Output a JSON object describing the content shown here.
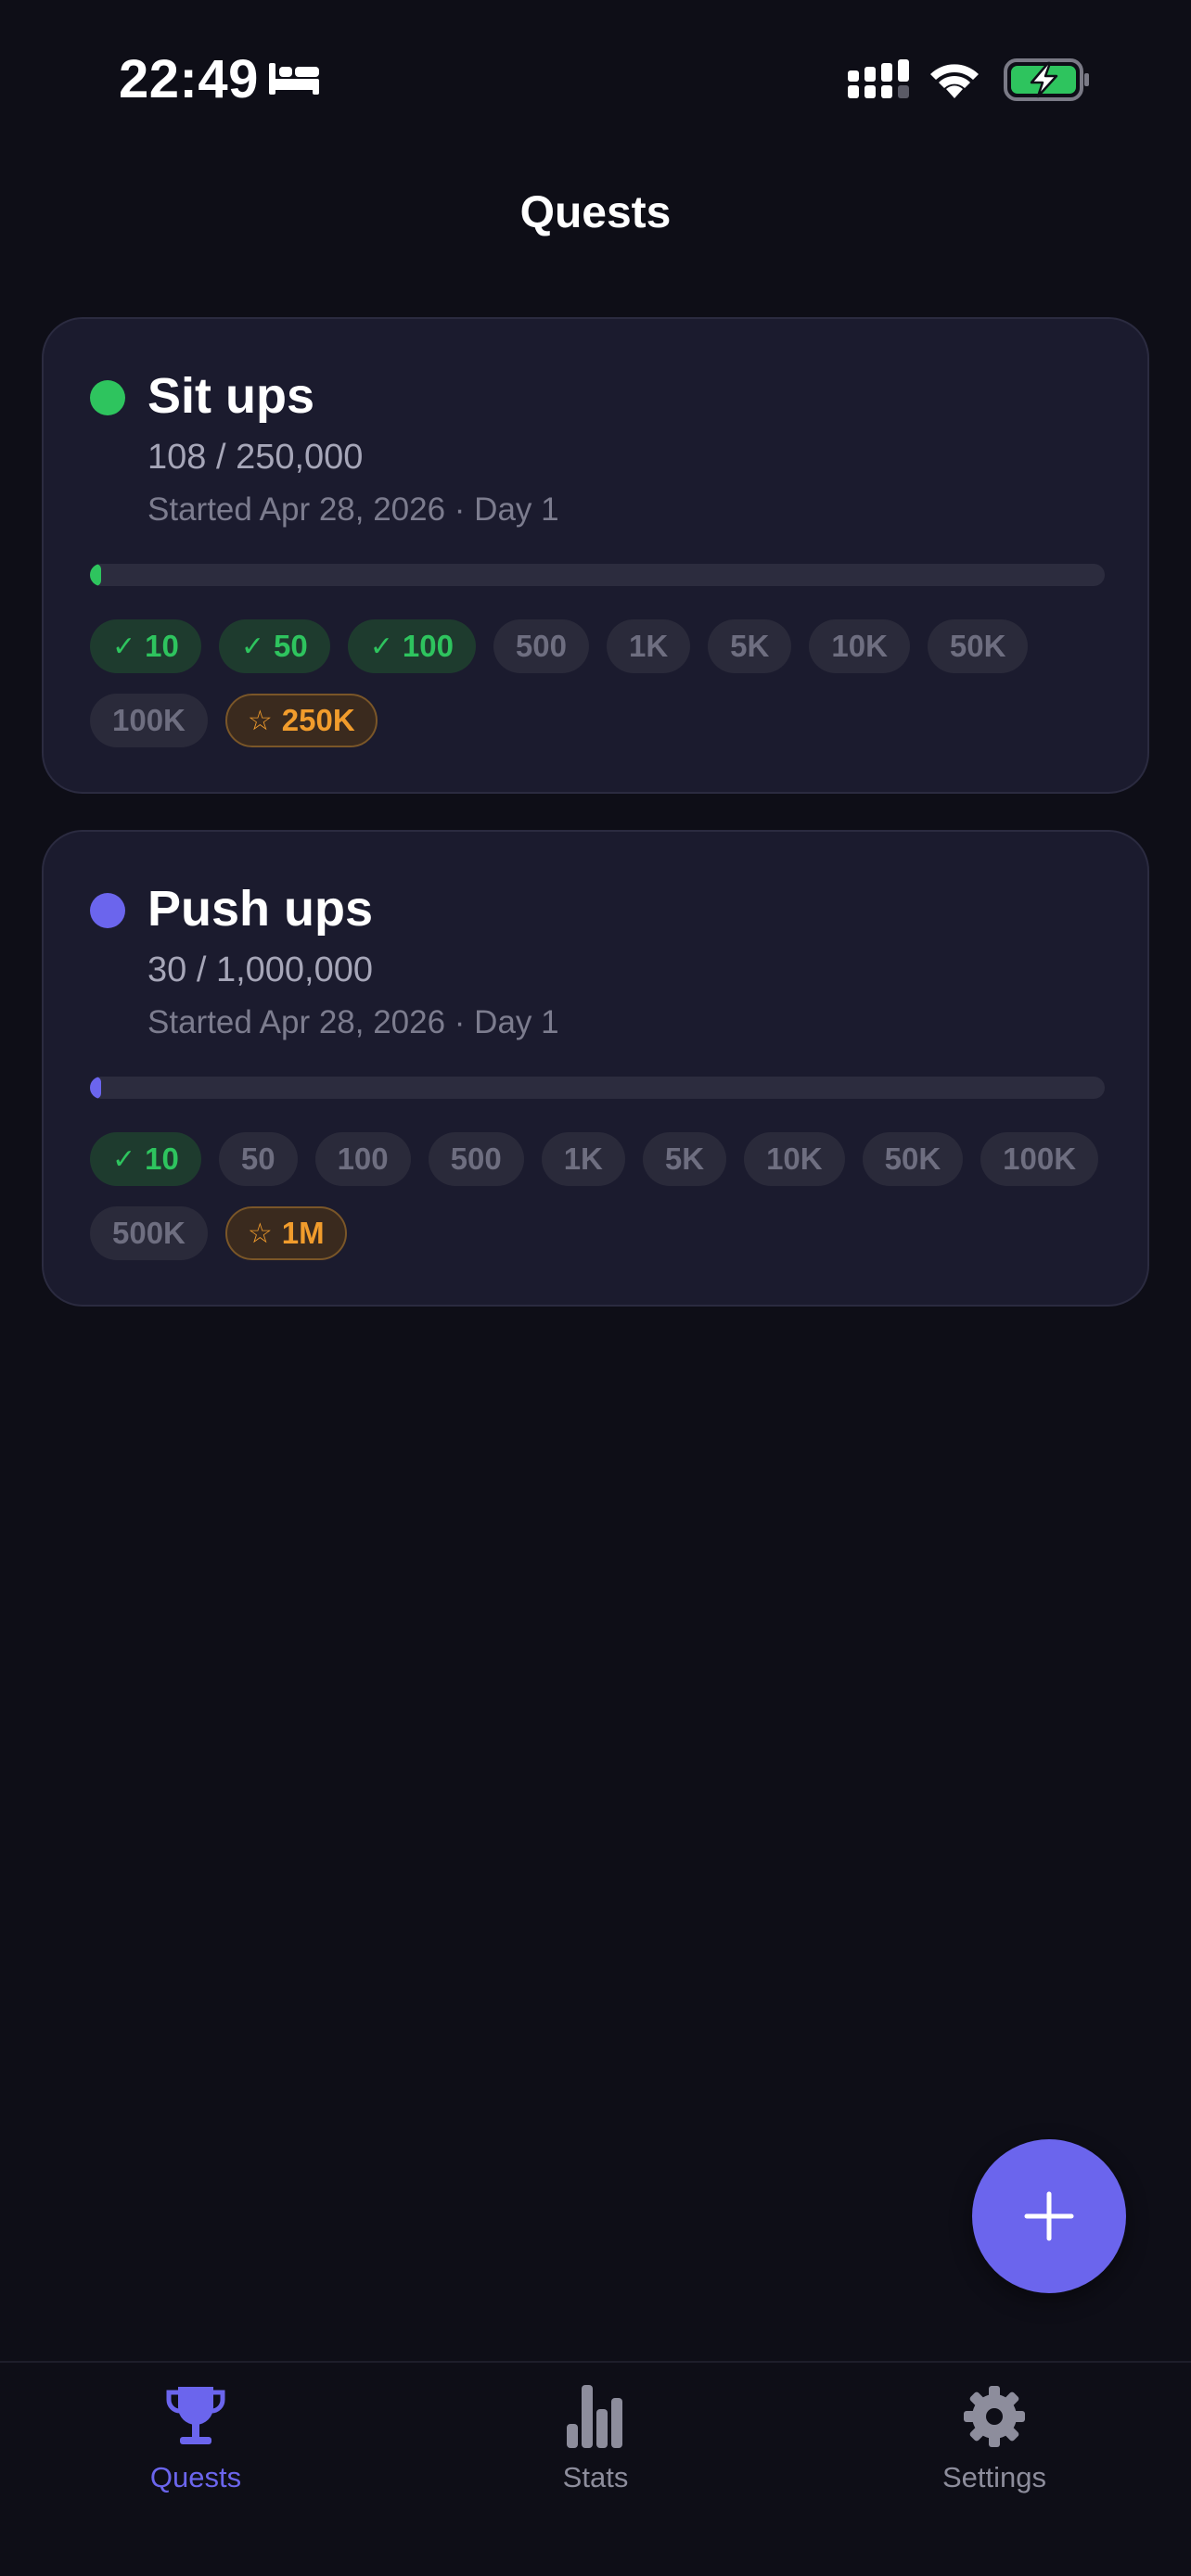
{
  "status_bar": {
    "time": "22:49",
    "icons": [
      "bed-icon",
      "signal-icon",
      "wifi-icon",
      "battery-charging-icon"
    ]
  },
  "header": {
    "title": "Quests"
  },
  "quests": [
    {
      "name": "Sit ups",
      "dot_color": "#2ec45e",
      "progress_text": "108 / 250,000",
      "started": "Started Apr 28, 2026 · Day 1",
      "progress_fraction": 0.000432,
      "milestones": [
        {
          "label": "10",
          "state": "done",
          "mark": "✓"
        },
        {
          "label": "50",
          "state": "done",
          "mark": "✓"
        },
        {
          "label": "100",
          "state": "done",
          "mark": "✓"
        },
        {
          "label": "500",
          "state": "todo",
          "mark": ""
        },
        {
          "label": "1K",
          "state": "todo",
          "mark": ""
        },
        {
          "label": "5K",
          "state": "todo",
          "mark": ""
        },
        {
          "label": "10K",
          "state": "todo",
          "mark": ""
        },
        {
          "label": "50K",
          "state": "todo",
          "mark": ""
        },
        {
          "label": "100K",
          "state": "todo",
          "mark": ""
        },
        {
          "label": "250K",
          "state": "goal",
          "mark": "☆"
        }
      ]
    },
    {
      "name": "Push ups",
      "dot_color": "#6b65ed",
      "progress_text": "30 / 1,000,000",
      "started": "Started Apr 28, 2026 · Day 1",
      "progress_fraction": 3e-05,
      "milestones": [
        {
          "label": "10",
          "state": "done",
          "mark": "✓"
        },
        {
          "label": "50",
          "state": "todo",
          "mark": ""
        },
        {
          "label": "100",
          "state": "todo",
          "mark": ""
        },
        {
          "label": "500",
          "state": "todo",
          "mark": ""
        },
        {
          "label": "1K",
          "state": "todo",
          "mark": ""
        },
        {
          "label": "5K",
          "state": "todo",
          "mark": ""
        },
        {
          "label": "10K",
          "state": "todo",
          "mark": ""
        },
        {
          "label": "50K",
          "state": "todo",
          "mark": ""
        },
        {
          "label": "100K",
          "state": "todo",
          "mark": ""
        },
        {
          "label": "500K",
          "state": "todo",
          "mark": ""
        },
        {
          "label": "1M",
          "state": "goal",
          "mark": "☆"
        }
      ]
    }
  ],
  "fab": {
    "icon": "plus-icon",
    "color": "#6b65ed"
  },
  "tab_bar": {
    "tabs": [
      {
        "label": "Quests",
        "icon": "trophy-icon",
        "active": true
      },
      {
        "label": "Stats",
        "icon": "bar-chart-icon",
        "active": false
      },
      {
        "label": "Settings",
        "icon": "gear-icon",
        "active": false
      }
    ],
    "active_color": "#6b65ed",
    "inactive_color": "#8d8d9c"
  }
}
